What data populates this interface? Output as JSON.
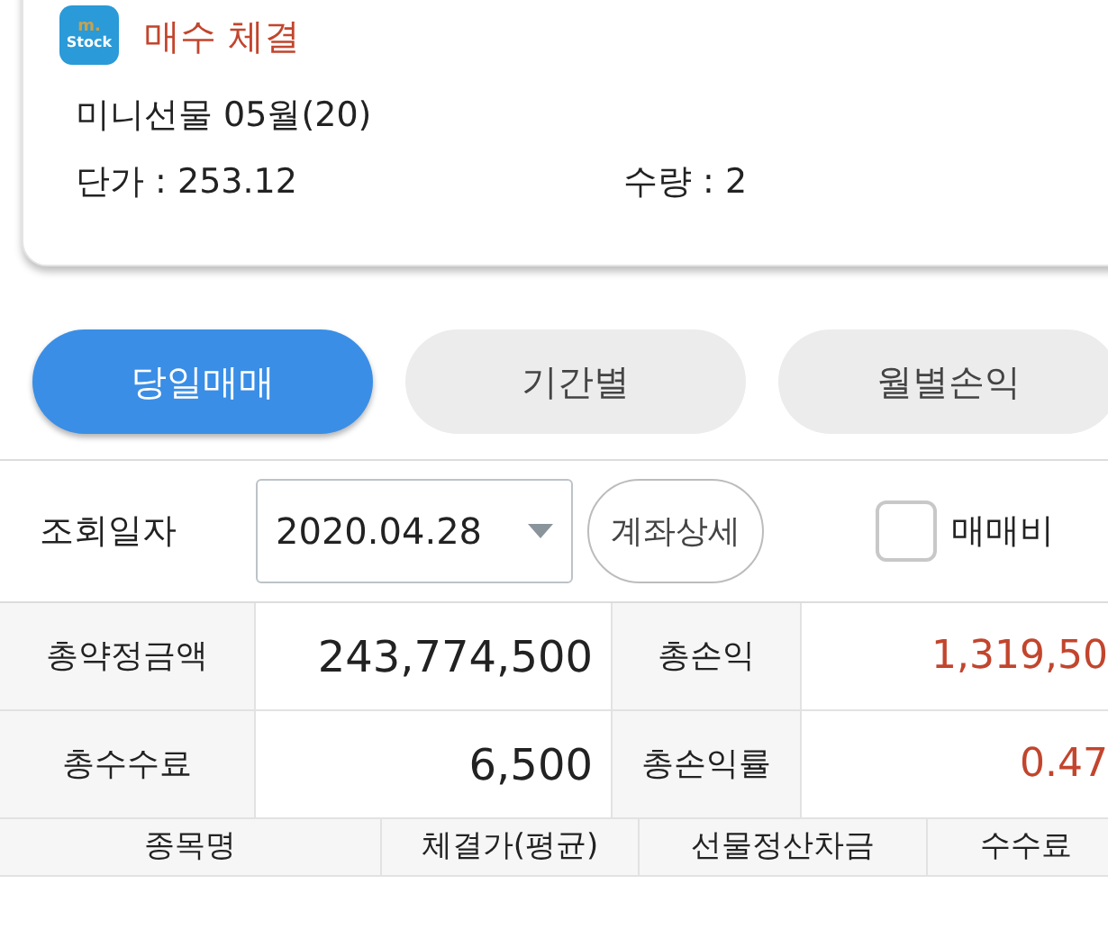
{
  "notification": {
    "app_icon_text": [
      "m.",
      "Stock"
    ],
    "title": "매수 체결",
    "product": "미니선물 05월(20)",
    "price": "단가 : 253.12",
    "quantity": "수량 : 2"
  },
  "tabs": [
    {
      "label": "당일매매",
      "selected": true
    },
    {
      "label": "기간별",
      "selected": false
    },
    {
      "label": "월별손익",
      "selected": false
    }
  ],
  "query": {
    "label": "조회일자",
    "date": "2020.04.28",
    "detail_button": "계좌상세",
    "cost_checkbox": {
      "label": "매매비",
      "checked": false
    }
  },
  "summary": [
    {
      "label": "총약정금액",
      "value": "243,774,500",
      "label2": "총손익",
      "value2": "1,319,50"
    },
    {
      "label": "총수수료",
      "value": "6,500",
      "label2": "총손익률",
      "value2": "0.47"
    }
  ],
  "table": {
    "columns": [
      "종목명",
      "체결가(평균)",
      "선물정산차금",
      "수수료"
    ]
  }
}
